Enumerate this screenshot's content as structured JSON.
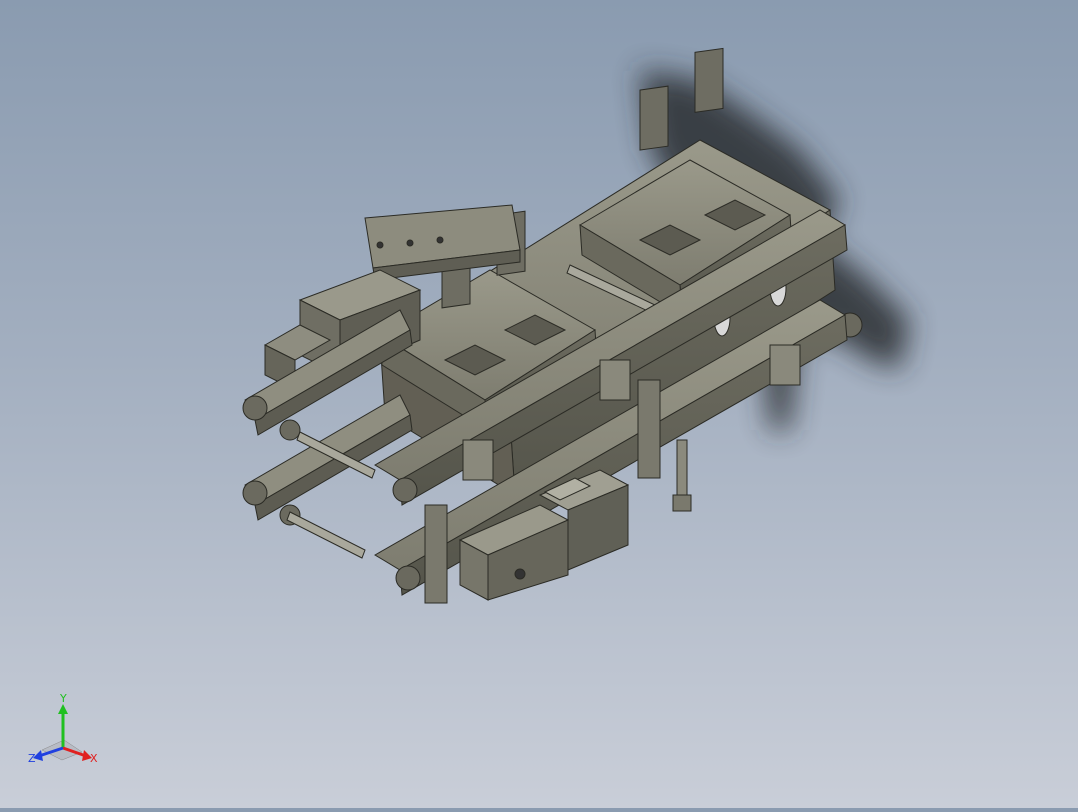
{
  "viewport": {
    "background_top": "#8a9bb0",
    "background_bottom": "#c9ced8",
    "model_color": "#7d7c6e"
  },
  "triad": {
    "x_label": "X",
    "y_label": "Y",
    "z_label": "Z",
    "x_color": "#e02020",
    "y_color": "#20c020",
    "z_color": "#2040e0"
  }
}
